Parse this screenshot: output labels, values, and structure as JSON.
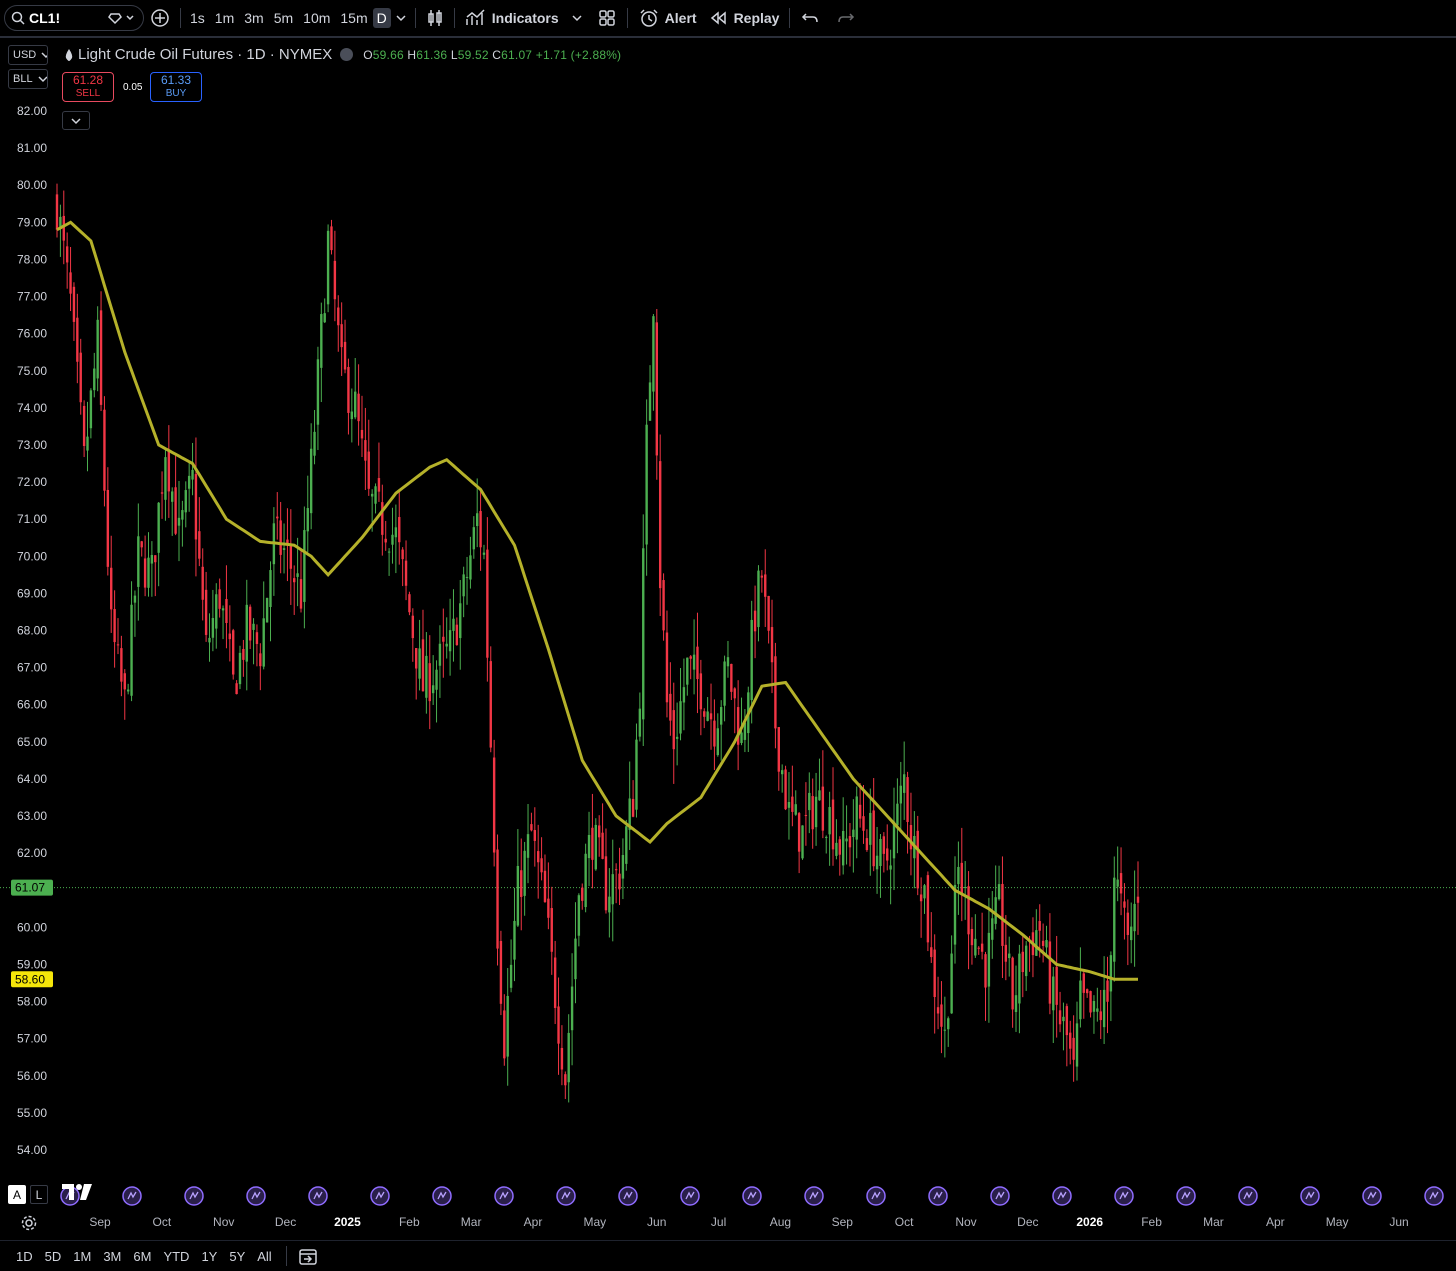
{
  "toolbar": {
    "symbol": "CL1!",
    "timeframes": [
      "1s",
      "1m",
      "3m",
      "5m",
      "10m",
      "15m",
      "D"
    ],
    "indicators_label": "Indicators",
    "alert_label": "Alert",
    "replay_label": "Replay"
  },
  "left_controls": {
    "currency": "USD",
    "unit": "BLL"
  },
  "legend": {
    "title": "Light Crude Oil Futures · 1D · NYMEX",
    "open_label": "O",
    "open": "59.66",
    "high_label": "H",
    "high": "61.36",
    "low_label": "L",
    "low": "59.52",
    "close_label": "C",
    "close": "61.07",
    "change": "+1.71 (+2.88%)"
  },
  "trade": {
    "sell_price": "61.28",
    "sell_label": "SELL",
    "spread": "0.05",
    "buy_price": "61.33",
    "buy_label": "BUY"
  },
  "scale_labels": {
    "left": "A",
    "right": "L"
  },
  "bottom_bar": {
    "ranges": [
      "1D",
      "5D",
      "1M",
      "3M",
      "6M",
      "YTD",
      "1Y",
      "5Y",
      "All"
    ]
  },
  "colors": {
    "up": "#4caf50",
    "down": "#f23645",
    "ma": "#b5b12a",
    "background": "#000000",
    "last_price": "#4caf50",
    "ma_label": "#f5e60a"
  },
  "chart_data": {
    "type": "candlestick",
    "ylim": [
      54,
      82
    ],
    "y_ticks": [
      "82.00",
      "81.00",
      "80.00",
      "79.00",
      "78.00",
      "77.00",
      "76.00",
      "75.00",
      "74.00",
      "73.00",
      "72.00",
      "71.00",
      "70.00",
      "69.00",
      "68.00",
      "67.00",
      "66.00",
      "65.00",
      "64.00",
      "63.00",
      "62.00",
      "61.00",
      "60.00",
      "59.00",
      "58.00",
      "57.00",
      "56.00",
      "55.00",
      "54.00"
    ],
    "x_ticks": [
      "Sep",
      "Oct",
      "Nov",
      "Dec",
      "2025",
      "Feb",
      "Mar",
      "Apr",
      "May",
      "Jun",
      "Jul",
      "Aug",
      "Sep",
      "Oct",
      "Nov",
      "Dec",
      "2026",
      "Feb",
      "Mar",
      "Apr",
      "May",
      "Jun"
    ],
    "bold_ticks": [
      "2025",
      "2026"
    ],
    "last_price": 61.07,
    "ma_last": 58.6,
    "events_count": 23,
    "anchor_closes": [
      [
        0,
        79.5
      ],
      [
        4,
        76.8
      ],
      [
        8,
        72.5
      ],
      [
        12,
        75.8
      ],
      [
        16,
        68.0
      ],
      [
        20,
        66.0
      ],
      [
        24,
        70.0
      ],
      [
        28,
        69.5
      ],
      [
        32,
        73.0
      ],
      [
        36,
        70.5
      ],
      [
        40,
        72.0
      ],
      [
        44,
        67.5
      ],
      [
        48,
        69.0
      ],
      [
        52,
        66.5
      ],
      [
        56,
        68.0
      ],
      [
        60,
        67.5
      ],
      [
        64,
        70.5
      ],
      [
        68,
        70.0
      ],
      [
        72,
        69.0
      ],
      [
        76,
        73.5
      ],
      [
        80,
        78.5
      ],
      [
        84,
        75.0
      ],
      [
        88,
        74.0
      ],
      [
        92,
        71.5
      ],
      [
        96,
        71.0
      ],
      [
        100,
        70.5
      ],
      [
        104,
        68.5
      ],
      [
        108,
        66.5
      ],
      [
        112,
        67.0
      ],
      [
        116,
        67.5
      ],
      [
        120,
        69.0
      ],
      [
        124,
        71.0
      ],
      [
        126,
        70.0
      ],
      [
        128,
        65.0
      ],
      [
        130,
        60.0
      ],
      [
        132,
        57.0
      ],
      [
        136,
        61.0
      ],
      [
        140,
        62.5
      ],
      [
        144,
        60.5
      ],
      [
        148,
        57.5
      ],
      [
        150,
        56.0
      ],
      [
        154,
        61.0
      ],
      [
        158,
        62.5
      ],
      [
        162,
        61.0
      ],
      [
        166,
        61.5
      ],
      [
        170,
        63.5
      ],
      [
        172,
        66.5
      ],
      [
        174,
        73.0
      ],
      [
        176,
        77.0
      ],
      [
        178,
        69.5
      ],
      [
        180,
        66.0
      ],
      [
        182,
        65.0
      ],
      [
        186,
        67.0
      ],
      [
        190,
        66.5
      ],
      [
        194,
        65.5
      ],
      [
        198,
        67.0
      ],
      [
        202,
        65.0
      ],
      [
        206,
        68.5
      ],
      [
        208,
        69.5
      ],
      [
        212,
        65.5
      ],
      [
        216,
        63.0
      ],
      [
        220,
        62.5
      ],
      [
        224,
        63.5
      ],
      [
        228,
        63.0
      ],
      [
        232,
        62.0
      ],
      [
        236,
        63.0
      ],
      [
        240,
        62.5
      ],
      [
        244,
        61.5
      ],
      [
        248,
        63.0
      ],
      [
        250,
        64.0
      ],
      [
        252,
        62.5
      ],
      [
        256,
        61.0
      ],
      [
        258,
        59.0
      ],
      [
        262,
        57.0
      ],
      [
        264,
        59.5
      ],
      [
        266,
        61.5
      ],
      [
        270,
        60.0
      ],
      [
        274,
        59.0
      ],
      [
        278,
        60.5
      ],
      [
        282,
        58.0
      ],
      [
        286,
        59.5
      ],
      [
        290,
        60.0
      ],
      [
        294,
        58.0
      ],
      [
        298,
        57.0
      ],
      [
        300,
        56.0
      ],
      [
        302,
        58.0
      ],
      [
        306,
        57.5
      ],
      [
        310,
        58.0
      ],
      [
        312,
        61.5
      ],
      [
        314,
        60.5
      ],
      [
        316,
        59.5
      ],
      [
        318,
        60.5
      ],
      [
        319,
        61.07
      ]
    ],
    "ma_points": [
      [
        0,
        78.8
      ],
      [
        4,
        79.0
      ],
      [
        10,
        78.5
      ],
      [
        20,
        75.5
      ],
      [
        30,
        73.0
      ],
      [
        40,
        72.5
      ],
      [
        50,
        71.0
      ],
      [
        60,
        70.4
      ],
      [
        70,
        70.3
      ],
      [
        75,
        70.0
      ],
      [
        80,
        69.5
      ],
      [
        90,
        70.5
      ],
      [
        100,
        71.7
      ],
      [
        110,
        72.4
      ],
      [
        115,
        72.6
      ],
      [
        125,
        71.8
      ],
      [
        135,
        70.3
      ],
      [
        145,
        67.5
      ],
      [
        155,
        64.5
      ],
      [
        165,
        63.0
      ],
      [
        175,
        62.3
      ],
      [
        180,
        62.8
      ],
      [
        190,
        63.5
      ],
      [
        200,
        65.0
      ],
      [
        208,
        66.5
      ],
      [
        215,
        66.6
      ],
      [
        225,
        65.3
      ],
      [
        235,
        64.0
      ],
      [
        245,
        63.0
      ],
      [
        255,
        62.0
      ],
      [
        265,
        61.0
      ],
      [
        275,
        60.5
      ],
      [
        285,
        59.8
      ],
      [
        295,
        59.0
      ],
      [
        305,
        58.8
      ],
      [
        312,
        58.6
      ],
      [
        319,
        58.6
      ]
    ],
    "n_bars": 320
  }
}
